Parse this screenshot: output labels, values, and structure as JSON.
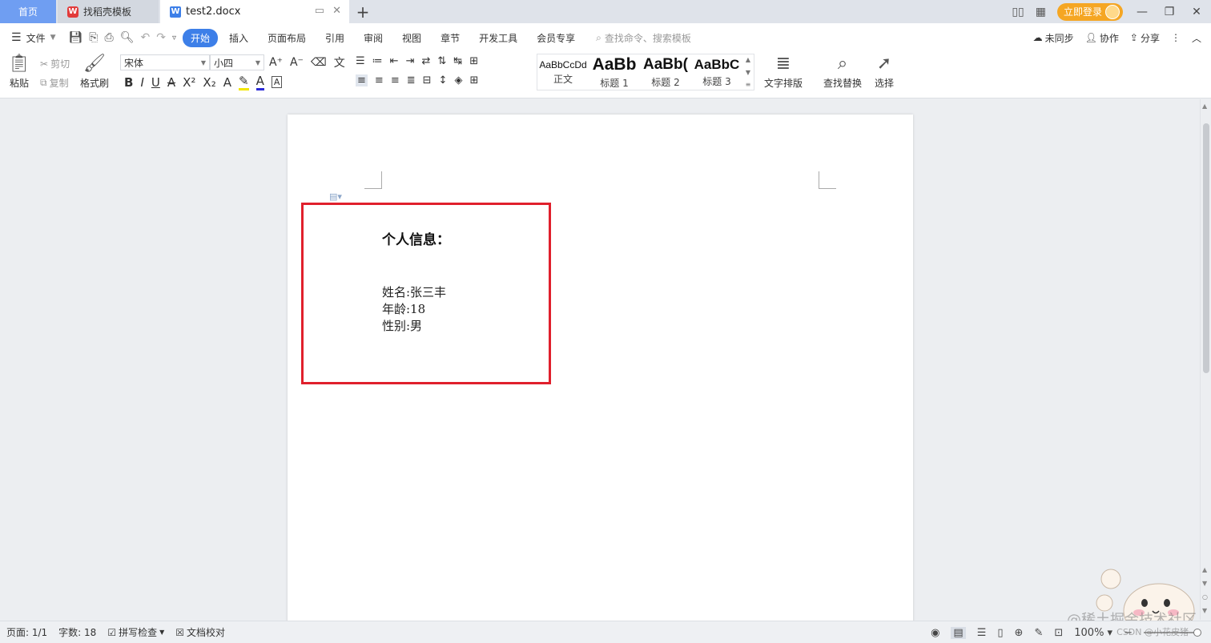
{
  "tabs": {
    "home": "首页",
    "template": "找稻壳模板",
    "document": "test2.docx",
    "new_tab": "+"
  },
  "titlebar": {
    "login": "立即登录"
  },
  "menubar": {
    "file": "文件",
    "items": [
      "开始",
      "插入",
      "页面布局",
      "引用",
      "审阅",
      "视图",
      "章节",
      "开发工具",
      "会员专享"
    ],
    "active_index": 0,
    "search_placeholder": "查找命令、搜索模板",
    "sync": "未同步",
    "collab": "协作",
    "share": "分享"
  },
  "ribbon": {
    "paste": "粘贴",
    "cut": "剪切",
    "copy": "复制",
    "format_painter": "格式刷",
    "font_name": "宋体",
    "font_size": "小四",
    "styles": [
      {
        "preview": "AaBbCcDd",
        "name": "正文"
      },
      {
        "preview": "AaBb",
        "name": "标题 1"
      },
      {
        "preview": "AaBb(",
        "name": "标题 2"
      },
      {
        "preview": "AaBbC",
        "name": "标题 3"
      }
    ],
    "text_layout": "文字排版",
    "find_replace": "查找替换",
    "select": "选择"
  },
  "document": {
    "heading": "个人信息：",
    "lines": [
      "姓名:张三丰",
      "年龄:18",
      "性别:男"
    ]
  },
  "status": {
    "page": "页面: 1/1",
    "words": "字数: 18",
    "spellcheck": "拼写检查",
    "proofread": "文档校对",
    "zoom": "100%"
  },
  "watermark": {
    "main": "@稀土掘金技术社区",
    "sub": "CSDN @小花皮猪"
  },
  "colors": {
    "accent": "#3d7fe8",
    "highlight_box": "#e0202c",
    "login": "#f5a623"
  }
}
